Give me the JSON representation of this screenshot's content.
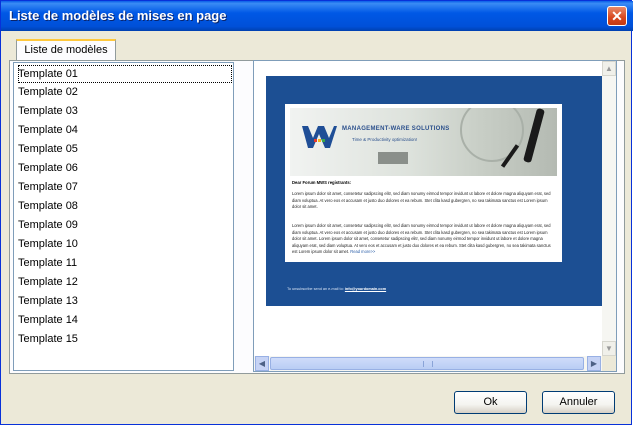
{
  "window": {
    "title": "Liste de modèles de mises en page"
  },
  "tab": {
    "label": "Liste de modèles"
  },
  "templates": [
    "Template 01",
    "Template 02",
    "Template 03",
    "Template 04",
    "Template 05",
    "Template 06",
    "Template 07",
    "Template 08",
    "Template 09",
    "Template 10",
    "Template 11",
    "Template 12",
    "Template 13",
    "Template 14",
    "Template 15"
  ],
  "selected_template": "Template 01",
  "preview": {
    "logo_title": "MANAGEMENT-WARE SOLUTIONS",
    "logo_tagline": "Time & Productivity optimization!",
    "greeting": "Dear Forum MWS registrants:",
    "para1": "Lorem ipsum dolor sit amet, consetetur sadipscing elitr, sed diam nonumy eirmod tempor invidunt ut labore et dolore magna aliquyam erat, sed diam voluptua. At vero eos et accusam et justo duo dolores et ea rebum. Stet clita kasd gubergren, no sea takimata sanctus est Lorem ipsum dolor sit amet.",
    "para2": "Lorem ipsum dolor sit amet, consetetur sadipscing elitr, sed diam nonumy eirmod tempor invidunt ut labore et dolore magna aliquyam erat, sed diam voluptua. At vero eos et accusam et justo duo dolores et ea rebum. Stet clita kasd gubergren, no sea takimata sanctus est Lorem ipsum dolor sit amet. Lorem ipsum dolor sit amet, consetetur sadipscing elitr, sed diam nonumy eirmod tempor invidunt ut labore et dolore magna aliquyam erat, sed diam voluptua. At vero eos et accusam et justo duo dolores et ea rebum. Stet clita kasd gubergren, no sea takimata sanctus est Lorem ipsum dolor sit amet.",
    "read_more": "Read more>>",
    "footer_text": "To unsubscribe send an e-mail to:",
    "footer_email": "info@yourdomain.com"
  },
  "buttons": {
    "ok": "Ok",
    "cancel": "Annuler"
  },
  "icons": {
    "close": "close-icon",
    "scroll_up": "arrow-up-icon",
    "scroll_down": "arrow-down-icon",
    "scroll_left": "arrow-left-icon",
    "scroll_right": "arrow-right-icon"
  },
  "colors": {
    "titlebar": "#0058e6",
    "close_button": "#d8461e",
    "newsletter_background": "#1c4f93"
  }
}
